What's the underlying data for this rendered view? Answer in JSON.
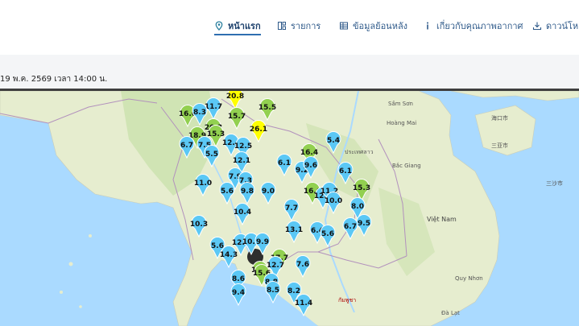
{
  "nav": {
    "items": [
      {
        "label": "หน้าแรก",
        "icon": "pin-icon",
        "active": true
      },
      {
        "label": "รายการ",
        "icon": "list-icon",
        "active": false
      },
      {
        "label": "ข้อมูลย้อนหลัง",
        "icon": "table-icon",
        "active": false
      },
      {
        "label": "เกี่ยวกับคุณภาพอากาศ",
        "icon": "info-icon",
        "active": false
      },
      {
        "label": "ดาวน์โหลด",
        "icon": "download-icon",
        "active": false
      }
    ]
  },
  "date_label": "19 พ.ค. 2569 เวลา 14:00 น.",
  "colors": {
    "accent": "#2f6fb0",
    "sea": "#aadaff",
    "land": "#e6edcf",
    "marker_blue": "#5bc8f5",
    "marker_green": "#92d050",
    "marker_yellow": "#ffff00"
  },
  "map": {
    "place_labels": [
      "海口市",
      "三亚市",
      "Sầm Sơn",
      "Hoàng Mai",
      "Bắc Giang",
      "Việt Nam",
      "Quy Nhơn",
      "Đà Lạt",
      "三沙市",
      "ประเทศลาว",
      "กัมพูชา"
    ],
    "stations": [
      {
        "value": "20.8",
        "level": "yellow"
      },
      {
        "value": "15.5",
        "level": "green"
      },
      {
        "value": "16.0",
        "level": "green"
      },
      {
        "value": "11.7",
        "level": "blue"
      },
      {
        "value": "8.3",
        "level": "blue"
      },
      {
        "value": "15.7",
        "level": "green"
      },
      {
        "value": "20.3",
        "level": "green"
      },
      {
        "value": "26.1",
        "level": "yellow"
      },
      {
        "value": "18.9",
        "level": "green"
      },
      {
        "value": "15.3",
        "level": "green"
      },
      {
        "value": "5.4",
        "level": "blue"
      },
      {
        "value": "6.7",
        "level": "blue"
      },
      {
        "value": "7.5",
        "level": "blue"
      },
      {
        "value": "5.5",
        "level": "blue"
      },
      {
        "value": "12.4",
        "level": "blue"
      },
      {
        "value": "12.5",
        "level": "blue"
      },
      {
        "value": "16.4",
        "level": "green"
      },
      {
        "value": "12.1",
        "level": "blue"
      },
      {
        "value": "6.1",
        "level": "blue"
      },
      {
        "value": "9.2",
        "level": "blue"
      },
      {
        "value": "9.6",
        "level": "blue"
      },
      {
        "value": "6.1",
        "level": "blue"
      },
      {
        "value": "7.9",
        "level": "blue"
      },
      {
        "value": "11.0",
        "level": "blue"
      },
      {
        "value": "7.3",
        "level": "blue"
      },
      {
        "value": "5.6",
        "level": "blue"
      },
      {
        "value": "9.8",
        "level": "blue"
      },
      {
        "value": "9.0",
        "level": "blue"
      },
      {
        "value": "16.0",
        "level": "green"
      },
      {
        "value": "12.8",
        "level": "blue"
      },
      {
        "value": "11.2",
        "level": "blue"
      },
      {
        "value": "10.0",
        "level": "blue"
      },
      {
        "value": "15.3",
        "level": "green"
      },
      {
        "value": "8.0",
        "level": "blue"
      },
      {
        "value": "7.7",
        "level": "blue"
      },
      {
        "value": "10.4",
        "level": "blue"
      },
      {
        "value": "10.3",
        "level": "blue"
      },
      {
        "value": "9.5",
        "level": "blue"
      },
      {
        "value": "6.7",
        "level": "blue"
      },
      {
        "value": "13.1",
        "level": "blue"
      },
      {
        "value": "6.4",
        "level": "blue"
      },
      {
        "value": "5.6",
        "level": "blue"
      },
      {
        "value": "12.2",
        "level": "blue"
      },
      {
        "value": "10.3",
        "level": "blue"
      },
      {
        "value": "9.9",
        "level": "blue"
      },
      {
        "value": "5.6",
        "level": "blue"
      },
      {
        "value": "14.3",
        "level": "blue"
      },
      {
        "value": "17.7",
        "level": "green"
      },
      {
        "value": "12.7",
        "level": "blue"
      },
      {
        "value": "7.6",
        "level": "blue"
      },
      {
        "value": "16.2",
        "level": "green"
      },
      {
        "value": "8.6",
        "level": "blue"
      },
      {
        "value": "15.6",
        "level": "green"
      },
      {
        "value": "8.8",
        "level": "blue"
      },
      {
        "value": "9.4",
        "level": "blue"
      },
      {
        "value": "8.5",
        "level": "blue"
      },
      {
        "value": "8.2",
        "level": "blue"
      },
      {
        "value": "11.4",
        "level": "blue"
      }
    ]
  }
}
